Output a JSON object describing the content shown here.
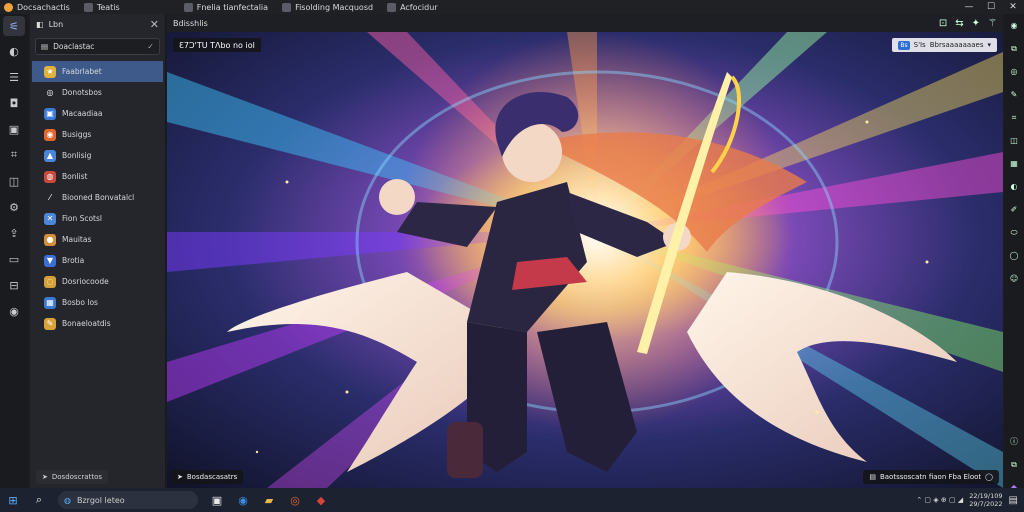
{
  "titlebar": {
    "tabs": [
      {
        "label": "Docsachactis",
        "icon": "app-logo-icon"
      },
      {
        "label": "Teatis",
        "icon": "doc-icon"
      },
      {
        "label": "Fnelia tianfectalia",
        "icon": "doc-icon"
      },
      {
        "label": "Fisolding Macquosd",
        "icon": "doc-icon"
      },
      {
        "label": "Acfocidur",
        "icon": "doc-icon"
      }
    ],
    "controls": {
      "minimize": "—",
      "maximize": "☐",
      "close": "✕"
    }
  },
  "left_rail": {
    "icons": [
      "sliders-icon",
      "chat-icon",
      "list-icon",
      "camera-icon",
      "image-icon",
      "crop-icon",
      "layers-icon",
      "settings-icon",
      "upload-icon",
      "tv-icon",
      "save-icon",
      "circle-icon"
    ]
  },
  "panel": {
    "header": "Lbn",
    "close": "✕",
    "select": {
      "label": "Doaclastac",
      "check": "✓"
    },
    "items": [
      {
        "label": "Faabrlabet",
        "icon": "star-icon",
        "color": "#e0b13b",
        "glyph": "★"
      },
      {
        "label": "Donotsbos",
        "icon": "circle-icon",
        "color": "transparent",
        "glyph": "◎"
      },
      {
        "label": "Macaadiaa",
        "icon": "image-icon",
        "color": "#3c7ad6",
        "glyph": "▣"
      },
      {
        "label": "Busiggs",
        "icon": "orange-app-icon",
        "color": "#e2672f",
        "glyph": "◉"
      },
      {
        "label": "Bonlisig",
        "icon": "blue-app-icon",
        "color": "#4b86d9",
        "glyph": "▲"
      },
      {
        "label": "Bonlist",
        "icon": "globe-icon",
        "color": "#c84a3c",
        "glyph": "◍"
      },
      {
        "label": "Biooned Bonvatalcl",
        "icon": "slash-icon",
        "color": "transparent",
        "glyph": "⁄"
      },
      {
        "label": "Fion Scotsl",
        "icon": "tool-icon",
        "color": "#4b86d9",
        "glyph": "✕"
      },
      {
        "label": "Mauitas",
        "icon": "badge-icon",
        "color": "#d28f3c",
        "glyph": "●"
      },
      {
        "label": "Brotia",
        "icon": "triangle-icon",
        "color": "#3c6fd6",
        "glyph": "▼"
      },
      {
        "label": "Dosriocoode",
        "icon": "ring-icon",
        "color": "#d4a03a",
        "glyph": "◌"
      },
      {
        "label": "Bosbo los",
        "icon": "grid-icon",
        "color": "#3c7ad6",
        "glyph": "▦"
      },
      {
        "label": "Bonaeloatdis",
        "icon": "pencil-icon",
        "color": "#d8a23b",
        "glyph": "✎"
      }
    ],
    "footer": "Dosdoscrattos"
  },
  "main": {
    "toolbar_title": "Bdisshlis",
    "toolbar_icons": [
      "crop-icon",
      "share-icon",
      "pin-icon",
      "wand-icon"
    ],
    "overlay_top_left": "Ɛ7Ɔ'TU TɅbo no iol",
    "overlay_top_right": {
      "badge": "Bs",
      "label": "S'Is",
      "text": "Bbrsaaaaaaaes"
    },
    "overlay_bottom_left": "Bosdascasatrs",
    "overlay_bottom_right": "Baotssoscatn fiaon Fba Eloot"
  },
  "right_rail": {
    "icons": [
      "record-icon",
      "copy-icon",
      "shield-icon",
      "edit-icon",
      "scan-icon",
      "layers-icon",
      "grid-icon",
      "contrast-icon",
      "pen-icon",
      "ellipse-icon",
      "circle-icon",
      "user-icon",
      "info-icon",
      "copy-icon",
      "app-icon"
    ]
  },
  "taskbar": {
    "search_placeholder": "Bzrgol leteo",
    "tray_text": "⌃ ▢ ◈ ⊕ ▢ ◢",
    "clock_time": "22/19/109",
    "clock_date": "29/7/2022"
  },
  "colors": {
    "accent": "#3d5a8a",
    "taskbar": "#1d2230"
  }
}
